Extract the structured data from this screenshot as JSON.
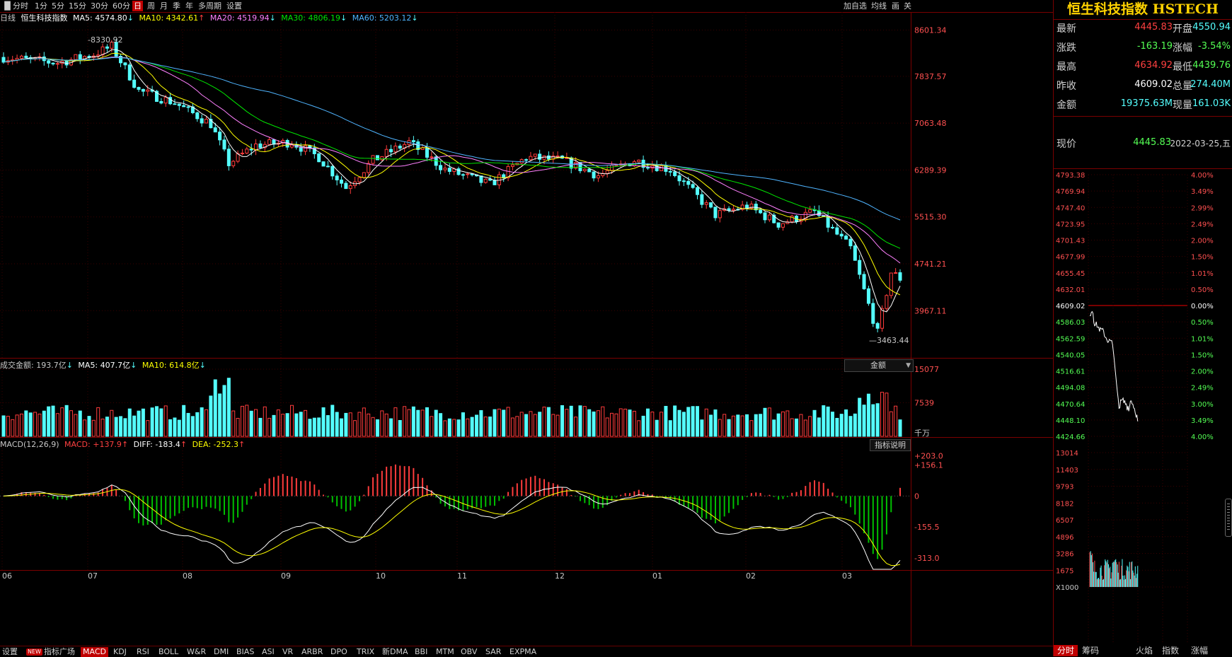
{
  "toolbar": {
    "items": [
      "分时",
      "1分",
      "5分",
      "15分",
      "30分",
      "60分",
      "日",
      "周",
      "月",
      "季",
      "年",
      "多周期",
      "设置"
    ],
    "active_index": 6,
    "right_items": [
      "加自选",
      "均线",
      "画",
      "关"
    ]
  },
  "main_chart": {
    "legend": {
      "period": "日线",
      "name": "恒生科技指数",
      "ma5": "MA5: 4574.80",
      "ma10": "MA10: 4342.61",
      "ma20": "MA20: 4519.94",
      "ma30": "MA30: 4806.19",
      "ma60": "MA60: 5203.12"
    },
    "y_ticks": [
      "8601.34",
      "7837.57",
      "7063.48",
      "6289.39",
      "5515.30",
      "4741.21",
      "3967.11"
    ],
    "y_range": [
      3200,
      8700
    ],
    "high_label": "8330.92",
    "low_label": "3463.44",
    "x_labels": [
      "06",
      "07",
      "08",
      "09",
      "10",
      "11",
      "12",
      "01",
      "02",
      "03"
    ],
    "colors": {
      "up": "#ff3c3c",
      "down": "#54ffff",
      "ma5": "#ffffff",
      "ma10": "#ffff00",
      "ma20": "#ff80ff",
      "ma30": "#00e600",
      "ma60": "#4fb4ff"
    }
  },
  "volume_chart": {
    "legend": {
      "label": "成交金额: 193.7亿",
      "ma5": "MA5: 407.7亿",
      "ma10": "MA10: 614.8亿"
    },
    "selector": "金额",
    "y_ticks": [
      "15077",
      "7539"
    ],
    "unit": "千万",
    "y_max": 15077
  },
  "macd_chart": {
    "legend": {
      "name": "MACD(12,26,9)",
      "macd": "MACD: +137.9",
      "diff": "DIFF: -183.4",
      "dea": "DEA: -252.3"
    },
    "help_button": "指标说明",
    "y_ticks": [
      "+203.0",
      "+156.1",
      "0",
      "-155.5",
      "-313.0"
    ],
    "y_range": [
      -370,
      230
    ]
  },
  "bottom_tabs": {
    "items": [
      "设置",
      "NEW",
      "指标广场",
      "MACD",
      "KDJ",
      "RSI",
      "BOLL",
      "W&R",
      "DMI",
      "BIAS",
      "ASI",
      "VR",
      "ARBR",
      "DPO",
      "TRIX",
      "新DMA",
      "BBI",
      "MTM",
      "OBV",
      "SAR",
      "EXPMA"
    ],
    "active_index": 3
  },
  "right_panel": {
    "title": "恒生科技指数 HSTECH",
    "quotes": [
      {
        "l1": "最新",
        "v1": "4445.83",
        "c1": "#ff4040",
        "l2": "开盘",
        "v2": "4550.94",
        "c2": "#54ffff"
      },
      {
        "l1": "涨跌",
        "v1": "-163.19",
        "c1": "#54ff54",
        "l2": "涨幅",
        "v2": "-3.54%",
        "c2": "#54ff54"
      },
      {
        "l1": "最高",
        "v1": "4634.92",
        "c1": "#ff4040",
        "l2": "最低",
        "v2": "4439.76",
        "c2": "#54ff54"
      },
      {
        "l1": "昨收",
        "v1": "4609.02",
        "c1": "#ffffff",
        "l2": "总量",
        "v2": "274.40M",
        "c2": "#54ffff"
      },
      {
        "l1": "金额",
        "v1": "19375.63M",
        "c1": "#54ffff",
        "l2": "现量",
        "v2": "161.03K",
        "c2": "#54ffff"
      }
    ],
    "price_label": "现价",
    "price_value": "4445.83",
    "date": "2022-03-25,五",
    "intraday": {
      "y_prices": [
        "4793.38",
        "4769.94",
        "4747.40",
        "4723.95",
        "4701.43",
        "4677.99",
        "4655.45",
        "4632.01",
        "4609.02",
        "4586.03",
        "4562.59",
        "4540.05",
        "4516.61",
        "4494.08",
        "4470.64",
        "4448.10",
        "4424.66"
      ],
      "y_pcts": [
        "4.00%",
        "3.49%",
        "2.99%",
        "2.49%",
        "2.00%",
        "1.50%",
        "1.01%",
        "0.50%",
        "0.00%",
        "0.50%",
        "1.01%",
        "1.50%",
        "2.00%",
        "2.49%",
        "3.00%",
        "3.49%",
        "4.00%"
      ],
      "vol_ticks": [
        "13014",
        "11403",
        "9793",
        "8182",
        "6507",
        "4896",
        "3286",
        "1675",
        "X1000"
      ]
    },
    "tabs": [
      "分时",
      "筹码",
      "火焰",
      "指数",
      "涨幅"
    ],
    "active_tab": 0
  }
}
